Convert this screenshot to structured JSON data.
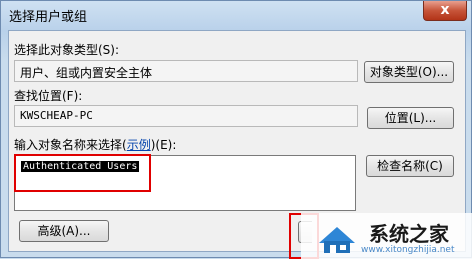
{
  "window": {
    "title": "选择用户或组",
    "close_label": "x"
  },
  "object_type": {
    "label": "选择此对象类型(S):",
    "value": "用户、组或内置安全主体",
    "button": "对象类型(O)..."
  },
  "location": {
    "label": "查找位置(F):",
    "value": "KWSCHEAP-PC",
    "button": "位置(L)..."
  },
  "names": {
    "label_prefix": "输入对象名称来选择(",
    "label_link": "示例",
    "label_suffix": ")(E):",
    "value": "Authenticated Users",
    "check_button": "检查名称(C)"
  },
  "footer": {
    "advanced_button": "高级(A)..."
  },
  "watermark": {
    "text": "系统之家",
    "url": "www.xitongzhijia.net"
  },
  "colors": {
    "highlight_border": "#e00000",
    "close_button": "#c7553a"
  }
}
